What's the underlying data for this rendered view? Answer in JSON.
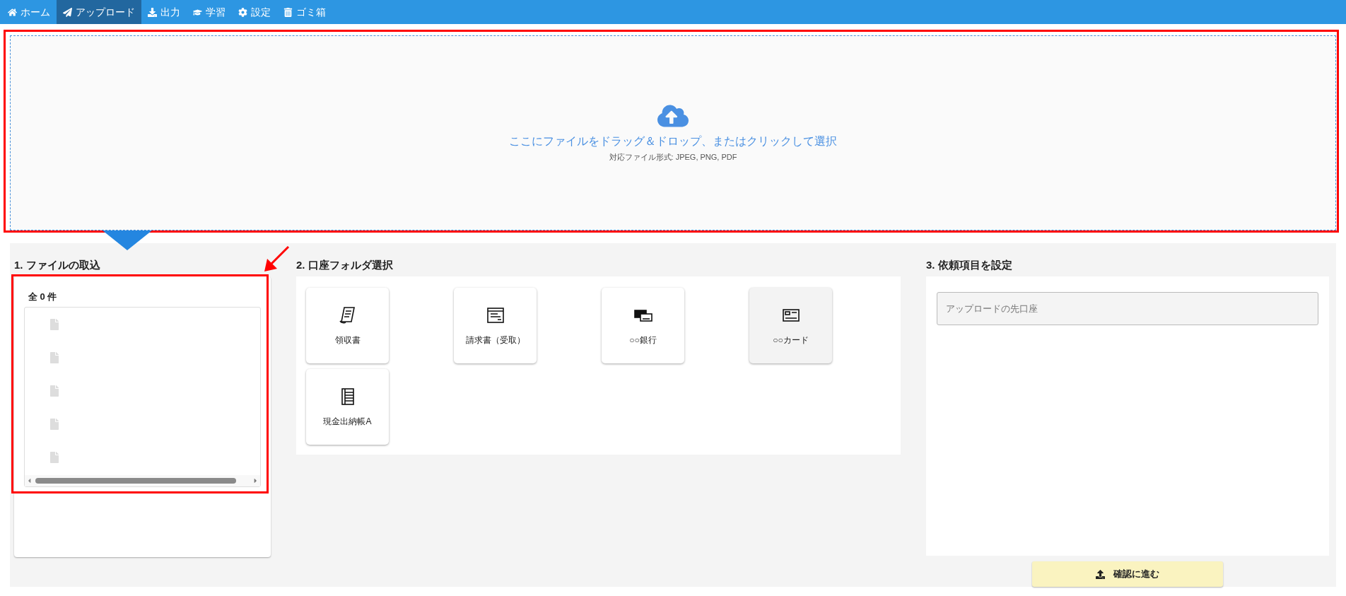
{
  "nav": {
    "tabs": [
      {
        "kind": "home",
        "label": "ホーム",
        "selected": false
      },
      {
        "kind": "send",
        "label": "アップロード",
        "selected": true
      },
      {
        "kind": "output",
        "label": "出力",
        "selected": false
      },
      {
        "kind": "learn",
        "label": "学習",
        "selected": false
      },
      {
        "kind": "settings",
        "label": "設定",
        "selected": false
      },
      {
        "kind": "trash",
        "label": "ゴミ箱",
        "selected": false
      }
    ]
  },
  "dropzone": {
    "prompt": "ここにファイルをドラッグ＆ドロップ、またはクリックして選択",
    "formats": "対応ファイル形式: JPEG, PNG, PDF"
  },
  "import_panel": {
    "title": "1. ファイルの取込",
    "count": "全 0 件"
  },
  "folder_panel": {
    "title": "2. 口座フォルダ選択",
    "folders": [
      {
        "kind": "receipt",
        "label": "領収書",
        "selected": false
      },
      {
        "kind": "invoice",
        "label": "請求書（受取）",
        "selected": false
      },
      {
        "kind": "bank",
        "label": "○○銀行",
        "selected": false
      },
      {
        "kind": "card",
        "label": "○○カード",
        "selected": true
      },
      {
        "kind": "ledger",
        "label": "現金出納帳A",
        "selected": false
      }
    ]
  },
  "settings_panel": {
    "title": "3. 依頼項目を設定",
    "destination": {
      "placeholder": "アップロードの先口座"
    }
  },
  "confirm_button": {
    "label": "確認に進む"
  }
}
